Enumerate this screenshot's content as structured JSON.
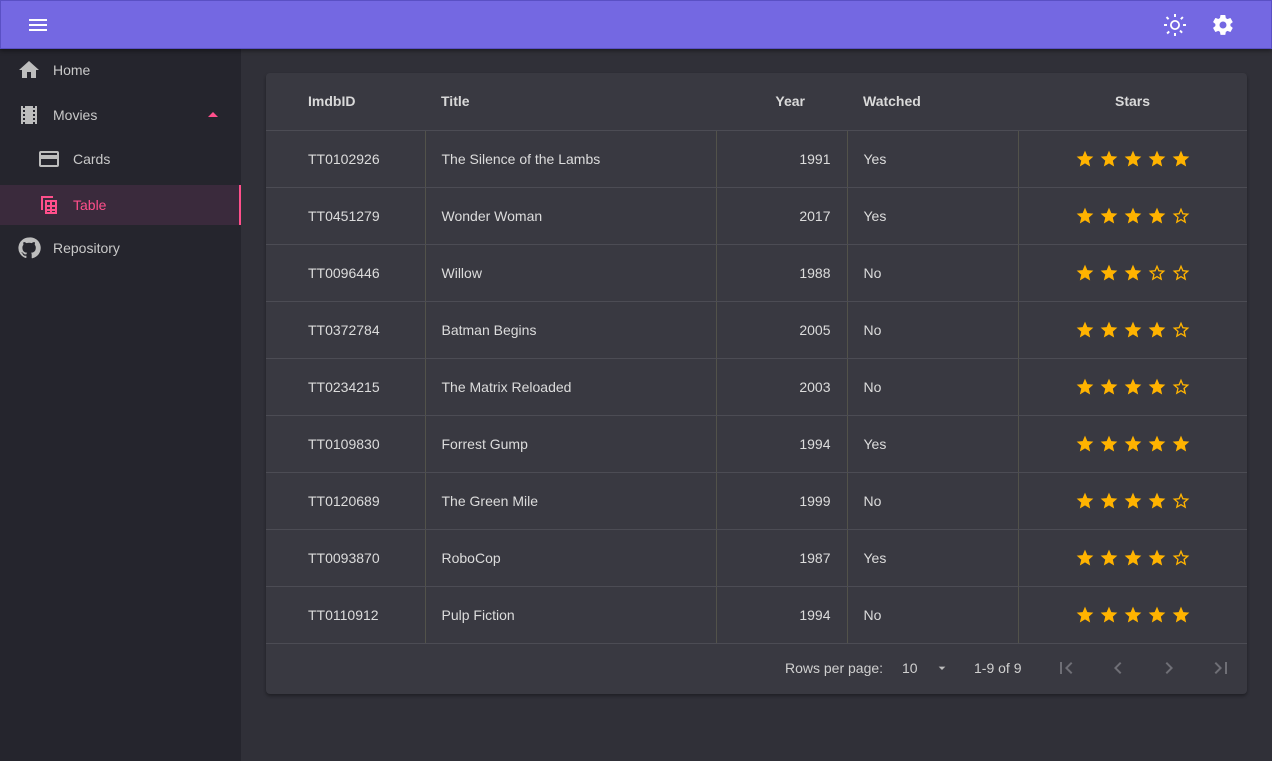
{
  "topbar": {
    "menu_icon": "menu-icon",
    "theme_icon": "brightness-icon",
    "settings_icon": "gear-icon",
    "color": "#7468e2"
  },
  "sidebar": {
    "items": [
      {
        "label": "Home",
        "icon": "home-icon"
      },
      {
        "label": "Movies",
        "icon": "film-icon"
      },
      {
        "label": "Cards",
        "icon": "card-icon"
      },
      {
        "label": "Table",
        "icon": "table-icon"
      },
      {
        "label": "Repository",
        "icon": "github-icon"
      }
    ],
    "active_color": "#ff4f8b"
  },
  "table": {
    "headers": {
      "id": "ImdbID",
      "title": "Title",
      "year": "Year",
      "watched": "Watched",
      "stars": "Stars"
    },
    "rows": [
      {
        "id": "TT0102926",
        "title": "The Silence of the Lambs",
        "year": "1991",
        "watched": "Yes",
        "stars": 5
      },
      {
        "id": "TT0451279",
        "title": "Wonder Woman",
        "year": "2017",
        "watched": "Yes",
        "stars": 4
      },
      {
        "id": "TT0096446",
        "title": "Willow",
        "year": "1988",
        "watched": "No",
        "stars": 3
      },
      {
        "id": "TT0372784",
        "title": "Batman Begins",
        "year": "2005",
        "watched": "No",
        "stars": 4
      },
      {
        "id": "TT0234215",
        "title": "The Matrix Reloaded",
        "year": "2003",
        "watched": "No",
        "stars": 4
      },
      {
        "id": "TT0109830",
        "title": "Forrest Gump",
        "year": "1994",
        "watched": "Yes",
        "stars": 5
      },
      {
        "id": "TT0120689",
        "title": "The Green Mile",
        "year": "1999",
        "watched": "No",
        "stars": 4
      },
      {
        "id": "TT0093870",
        "title": "RoboCop",
        "year": "1987",
        "watched": "Yes",
        "stars": 4
      },
      {
        "id": "TT0110912",
        "title": "Pulp Fiction",
        "year": "1994",
        "watched": "No",
        "stars": 5
      }
    ],
    "max_stars": 5,
    "star_color": "#ffb300"
  },
  "pagination": {
    "rows_per_page_label": "Rows per page:",
    "rows_per_page_value": "10",
    "range_text": "1-9 of 9"
  }
}
